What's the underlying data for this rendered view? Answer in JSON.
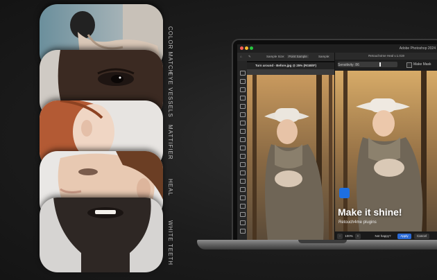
{
  "cards": [
    {
      "label": "COLOR MATCH"
    },
    {
      "label": "EYE VESSELS"
    },
    {
      "label": "MATTIFIER"
    },
    {
      "label": "HEAL"
    },
    {
      "label": "WHITE TEETH"
    }
  ],
  "photoshop": {
    "app_title": "Adobe Photoshop 2024",
    "options": {
      "sample_size_label": "Sample Size:",
      "sample_size_value": "Point Sample",
      "sample_label": "Sample:"
    },
    "document_tab": "Turn around - Before.jpg @ 25% (RGB/8*)",
    "plugin": {
      "title": "Retouch4me Heal v.1.019",
      "sensitivity_label": "Sensitivity: 86",
      "make_mask_label": "Make Mask",
      "headline": "Make it shine!",
      "subtitle": "Retouch4me plugins",
      "zoom_minus": "-",
      "zoom_value": "100%",
      "zoom_plus": "+",
      "not_happy_label": "Not happy?",
      "apply_label": "Apply",
      "cancel_label": "Cancel"
    }
  },
  "colors": {
    "accent_blue": "#1e6fe0",
    "apply_button": "#2a6ad6"
  }
}
